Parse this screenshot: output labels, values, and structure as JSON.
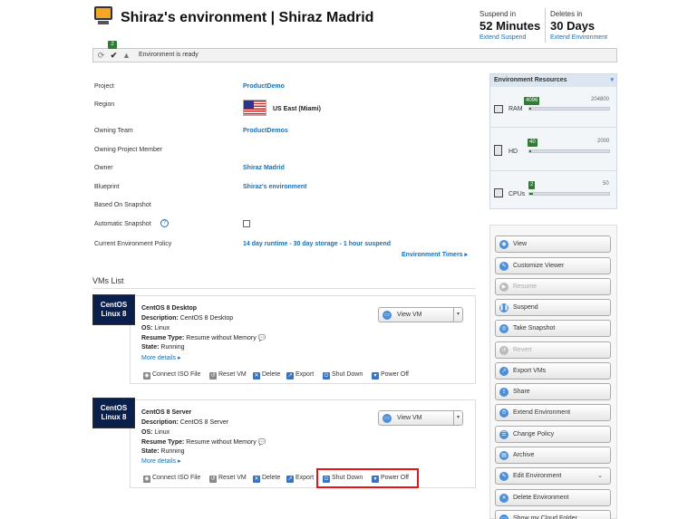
{
  "header": {
    "title": "Shiraz's environment | Shiraz Madrid",
    "suspend": {
      "label": "Suspend in",
      "value": "52 Minutes",
      "link": "Extend Suspend"
    },
    "deletes": {
      "label": "Deletes in",
      "value": "30 Days",
      "link": "Extend Environment"
    }
  },
  "status": {
    "message": "Environment is ready",
    "badge_count": "2",
    "icons": [
      "refresh-icon",
      "check-icon",
      "warning-icon"
    ]
  },
  "details": {
    "project": {
      "label": "Project",
      "value": "ProductDemo"
    },
    "region": {
      "label": "Region",
      "value": "US East (Miami)"
    },
    "owning_team": {
      "label": "Owning Team",
      "value": "ProductDemos"
    },
    "owning_member": {
      "label": "Owning Project Member",
      "value": ""
    },
    "owner": {
      "label": "Owner",
      "value": "Shiraz Madrid"
    },
    "blueprint": {
      "label": "Blueprint",
      "value": "Shiraz's environment"
    },
    "based_on_snapshot": {
      "label": "Based On Snapshot",
      "value": ""
    },
    "automatic_snapshot": {
      "label": "Automatic Snapshot",
      "checked": false
    },
    "policy": {
      "label": "Current Environment Policy",
      "value": "14 day runtime - 30 day storage - 1 hour suspend"
    },
    "timers_link": "Environment Timers ▸"
  },
  "vms": {
    "title": "VMs List",
    "items": [
      {
        "logo_line1": "CentOS",
        "logo_line2": "Linux 8",
        "name": "CentOS 8 Desktop",
        "desc_label": "Description:",
        "desc": "CentOS 8 Desktop",
        "os_label": "OS:",
        "os": "Linux",
        "resume_label": "Resume Type:",
        "resume": "Resume without Memory",
        "state_label": "State:",
        "state": "Running",
        "more": "More details ▸",
        "view_btn": "View VM"
      },
      {
        "logo_line1": "CentOS",
        "logo_line2": "Linux 8",
        "name": "CentOS 8 Server",
        "desc_label": "Description:",
        "desc": "CentOS 8 Server",
        "os_label": "OS:",
        "os": "Linux",
        "resume_label": "Resume Type:",
        "resume": "Resume without Memory",
        "state_label": "State:",
        "state": "Running",
        "more": "More details ▸",
        "view_btn": "View VM"
      }
    ],
    "actions": [
      "Connect ISO File",
      "Reset VM",
      "Delete",
      "Export",
      "Shut Down",
      "Power Off"
    ]
  },
  "resources": {
    "title": "Environment Resources",
    "ram": {
      "label": "RAM",
      "used": "4096",
      "max": "204800",
      "fraction": 0.02
    },
    "hd": {
      "label": "HD",
      "used": "40",
      "max": "2000",
      "fraction": 0.02
    },
    "cpus": {
      "label": "CPUs",
      "used": "2",
      "max": "50",
      "fraction": 0.04
    }
  },
  "actions_panel": [
    {
      "label": "View",
      "icon": "view-icon",
      "disabled": false
    },
    {
      "label": "Customize Viewer",
      "icon": "customize-icon",
      "disabled": false
    },
    {
      "label": "Resume",
      "icon": "resume-icon",
      "disabled": true
    },
    {
      "label": "Suspend",
      "icon": "suspend-icon",
      "disabled": false
    },
    {
      "label": "Take Snapshot",
      "icon": "snapshot-icon",
      "disabled": false
    },
    {
      "label": "Revert",
      "icon": "revert-icon",
      "disabled": true
    },
    {
      "label": "Export VMs",
      "icon": "export-icon",
      "disabled": false
    },
    {
      "label": "Share",
      "icon": "share-icon",
      "disabled": false
    },
    {
      "label": "Extend Environment",
      "icon": "extend-icon",
      "disabled": false
    },
    {
      "label": "Change Policy",
      "icon": "policy-icon",
      "disabled": false
    },
    {
      "label": "Archive",
      "icon": "archive-icon",
      "disabled": false
    },
    {
      "label": "Edit Environment",
      "icon": "edit-icon",
      "disabled": false
    },
    {
      "label": "Delete Environment",
      "icon": "delete-icon",
      "disabled": false
    },
    {
      "label": "Show my Cloud Folder",
      "icon": "folder-icon",
      "disabled": false
    }
  ],
  "colors": {
    "link": "#1a6fb5",
    "accent_green": "#2e7d32",
    "highlight_red": "#ee1111"
  }
}
